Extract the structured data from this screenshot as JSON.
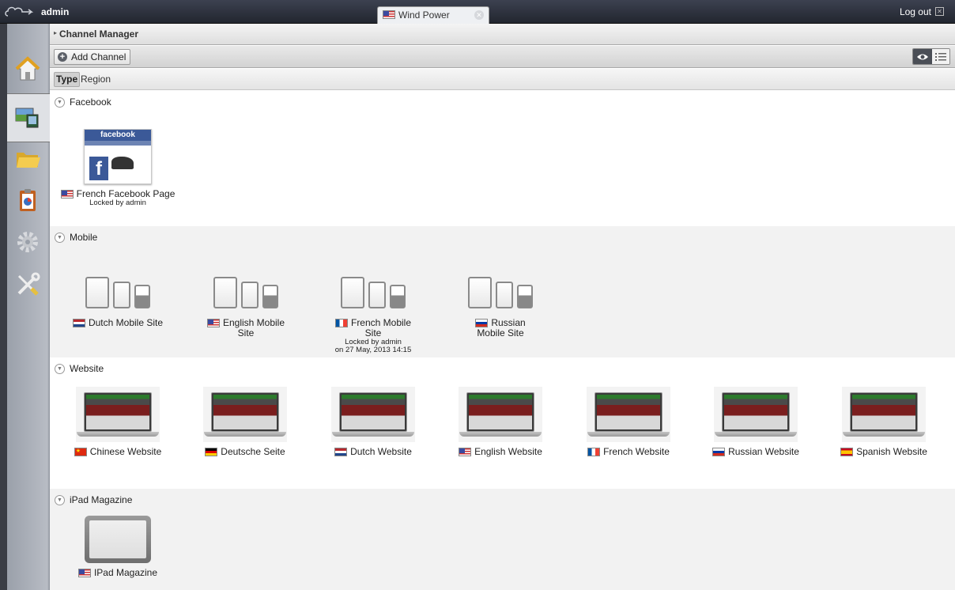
{
  "header": {
    "username": "admin",
    "active_tab": {
      "label": "Wind Power",
      "flag": "us"
    },
    "logout_label": "Log out"
  },
  "sidebar": {
    "items": [
      {
        "name": "home",
        "icon": "house-icon"
      },
      {
        "name": "channels",
        "icon": "channel-manager-icon",
        "active": true
      },
      {
        "name": "content",
        "icon": "folder-icon"
      },
      {
        "name": "reports",
        "icon": "clipboard-chart-icon"
      },
      {
        "name": "settings",
        "icon": "gear-icon"
      },
      {
        "name": "tools",
        "icon": "tools-icon"
      }
    ]
  },
  "breadcrumb": {
    "label": "Channel Manager"
  },
  "toolbar": {
    "add_label": "Add Channel",
    "view_modes": [
      "eye-icon",
      "list-icon"
    ]
  },
  "filters": {
    "type_label": "Type",
    "region_label": "Region"
  },
  "sections": [
    {
      "title": "Facebook",
      "items": [
        {
          "label": "French Facebook Page",
          "flag": "us",
          "lock": "Locked by admin"
        }
      ]
    },
    {
      "title": "Mobile",
      "items": [
        {
          "label": "Dutch Mobile Site",
          "flag": "nl"
        },
        {
          "label": "English Mobile Site",
          "flag": "us"
        },
        {
          "label": "French Mobile Site",
          "flag": "fr",
          "lock": "Locked by admin",
          "lock_date": "on 27 May, 2013 14:15"
        },
        {
          "label": "Russian Mobile Site",
          "flag": "ru"
        }
      ]
    },
    {
      "title": "Website",
      "items": [
        {
          "label": "Chinese Website",
          "flag": "cn"
        },
        {
          "label": "Deutsche Seite",
          "flag": "de"
        },
        {
          "label": "Dutch Website",
          "flag": "nl"
        },
        {
          "label": "English Website",
          "flag": "us"
        },
        {
          "label": "French Website",
          "flag": "fr"
        },
        {
          "label": "Russian Website",
          "flag": "ru"
        },
        {
          "label": "Spanish Website",
          "flag": "es"
        }
      ]
    },
    {
      "title": "iPad Magazine",
      "items": [
        {
          "label": "IPad Magazine",
          "flag": "us"
        }
      ]
    }
  ],
  "facebook_thumb_text": "facebook"
}
